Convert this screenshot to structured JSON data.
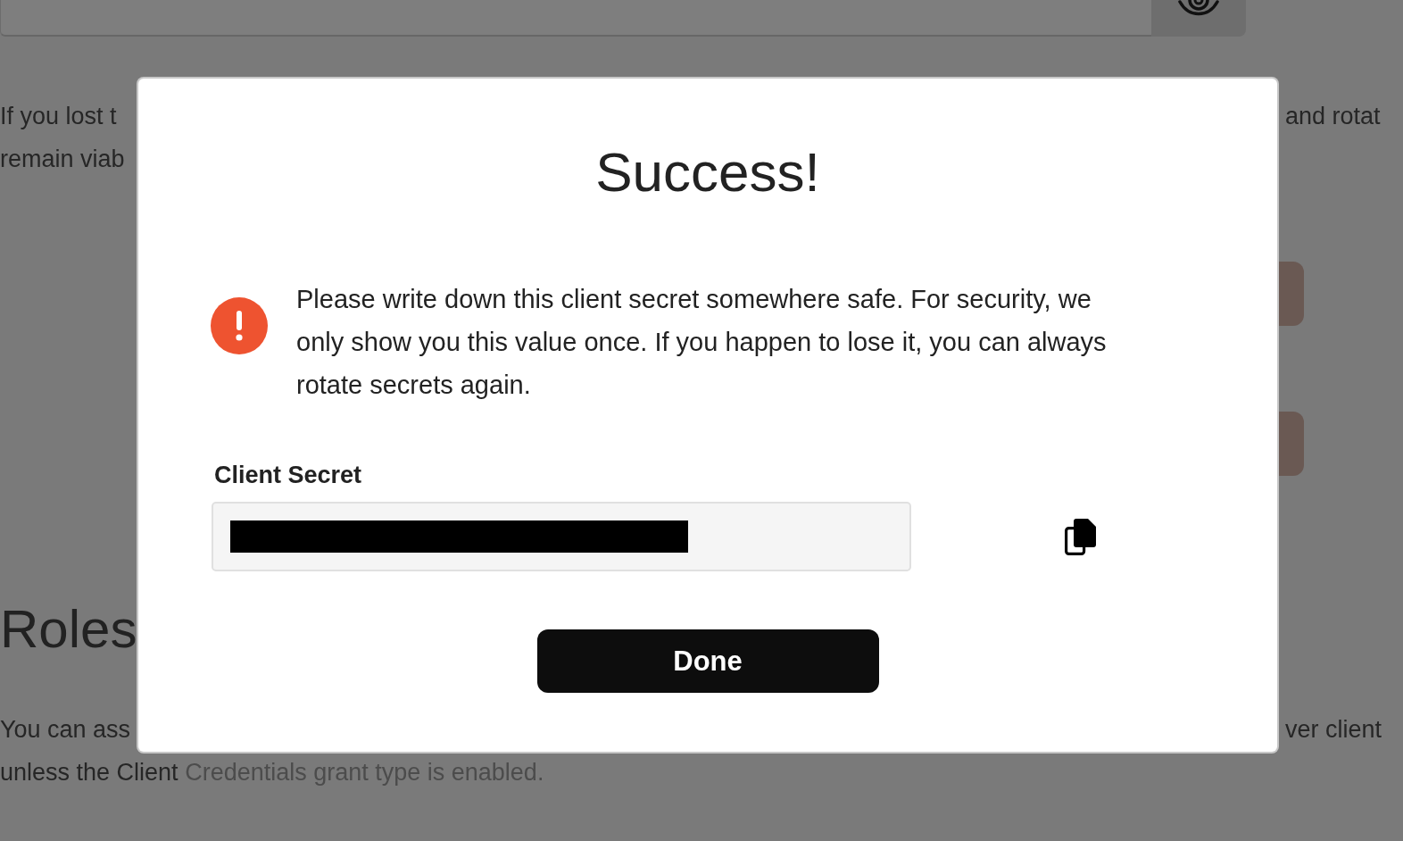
{
  "background": {
    "intro_lines": [
      {
        "left": "If you lost t",
        "right": "and rotat"
      },
      {
        "left": "remain viab"
      }
    ],
    "heading": "Roles",
    "roles_lines": [
      {
        "left": "You can ass",
        "right": "ver client"
      },
      {
        "text": "unless the Client",
        "link": "Credentials grant type is enabled."
      }
    ]
  },
  "dialog": {
    "title": "Success!",
    "alert": {
      "kind": "warning",
      "message": "Please write down this client secret somewhere safe. For security, we only show you this value once. If you happen to lose it, you can always rotate secrets again."
    },
    "field": {
      "label": "Client Secret",
      "redacted": true
    },
    "buttons": [
      {
        "label": "Done",
        "kind": "primary"
      }
    ]
  }
}
